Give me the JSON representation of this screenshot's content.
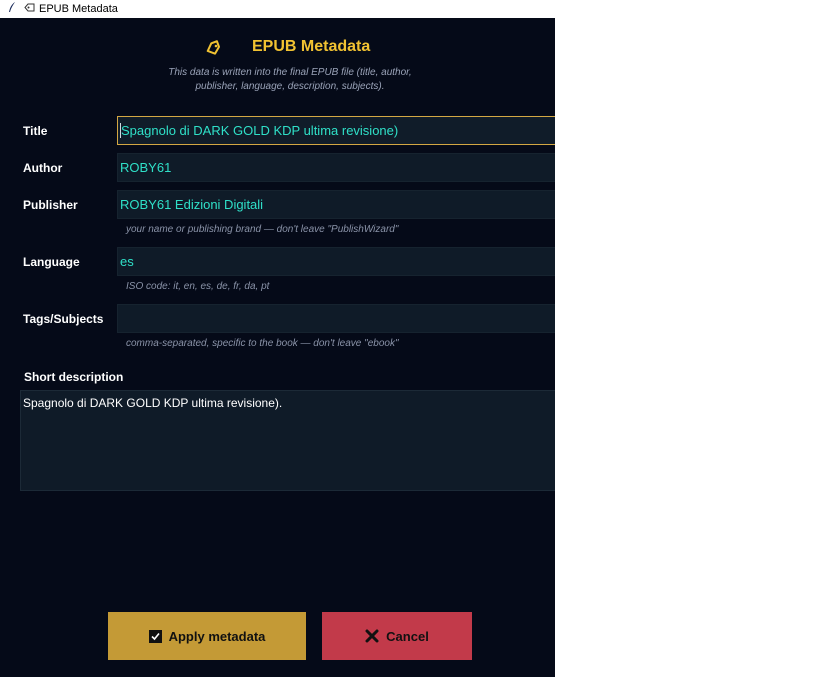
{
  "window": {
    "title": "EPUB Metadata"
  },
  "header": {
    "title": "EPUB Metadata",
    "subtitle_line1": "This data is written into the final EPUB file (title, author,",
    "subtitle_line2": "publisher, language, description, subjects)."
  },
  "form": {
    "title": {
      "label": "Title",
      "value": "Spagnolo di DARK GOLD KDP ultima revisione)"
    },
    "author": {
      "label": "Author",
      "value": "ROBY61"
    },
    "publisher": {
      "label": "Publisher",
      "value": "ROBY61 Edizioni Digitali",
      "hint": "your name or publishing brand — don't leave \"PublishWizard\""
    },
    "language": {
      "label": "Language",
      "value": "es",
      "hint": "ISO code: it, en, es, de, fr, da, pt"
    },
    "tags": {
      "label": "Tags/Subjects",
      "value": "",
      "hint": "comma-separated, specific to the book — don't leave \"ebook\""
    },
    "description": {
      "label": "Short description",
      "value": "Spagnolo di DARK GOLD KDP ultima revisione)."
    }
  },
  "buttons": {
    "apply_label": "Apply metadata",
    "cancel_label": "Cancel"
  },
  "colors": {
    "background": "#050a18",
    "accent_gold": "#f1c232",
    "field_text": "#2fe0c8",
    "apply_button": "#c49a36",
    "cancel_button": "#c23a4a"
  },
  "icons": {
    "app": "quill-icon",
    "window_tag": "tag-icon",
    "header": "tag-icon",
    "apply": "checkbox-icon",
    "cancel": "close-icon"
  }
}
